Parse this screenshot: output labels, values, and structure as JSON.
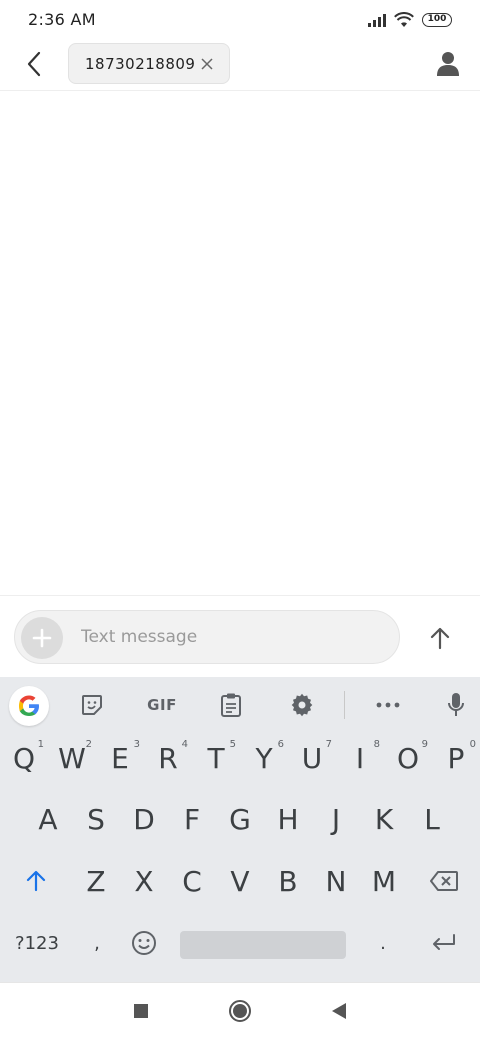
{
  "status_bar": {
    "time": "2:36 AM",
    "battery": "100",
    "icons": [
      "signal-icon",
      "wifi-icon",
      "battery-icon"
    ]
  },
  "header": {
    "recipient": "18730218809",
    "back_icon": "back-arrow-icon",
    "clear_icon": "close-icon",
    "contact_icon": "person-icon"
  },
  "compose": {
    "placeholder": "Text message",
    "add_icon": "plus-icon",
    "send_icon": "arrow-up-icon"
  },
  "keyboard": {
    "toolbar": {
      "gif_label": "GIF",
      "items": [
        "google-icon",
        "sticker-icon",
        "gif",
        "clipboard-icon",
        "settings-icon",
        "more-icon",
        "mic-icon"
      ]
    },
    "row1": [
      {
        "key": "Q",
        "hint": "1"
      },
      {
        "key": "W",
        "hint": "2"
      },
      {
        "key": "E",
        "hint": "3"
      },
      {
        "key": "R",
        "hint": "4"
      },
      {
        "key": "T",
        "hint": "5"
      },
      {
        "key": "Y",
        "hint": "6"
      },
      {
        "key": "U",
        "hint": "7"
      },
      {
        "key": "I",
        "hint": "8"
      },
      {
        "key": "O",
        "hint": "9"
      },
      {
        "key": "P",
        "hint": "0"
      }
    ],
    "row2": [
      "A",
      "S",
      "D",
      "F",
      "G",
      "H",
      "J",
      "K",
      "L"
    ],
    "row3": [
      "Z",
      "X",
      "C",
      "V",
      "B",
      "N",
      "M"
    ],
    "row4": {
      "symbols": "?123",
      "comma": ",",
      "period": "."
    },
    "colors": {
      "shift_accent": "#1a73e8",
      "background": "#e8eaed"
    }
  },
  "nav_bar": {
    "items": [
      "recents-square-icon",
      "home-circle-icon",
      "back-triangle-icon"
    ]
  }
}
